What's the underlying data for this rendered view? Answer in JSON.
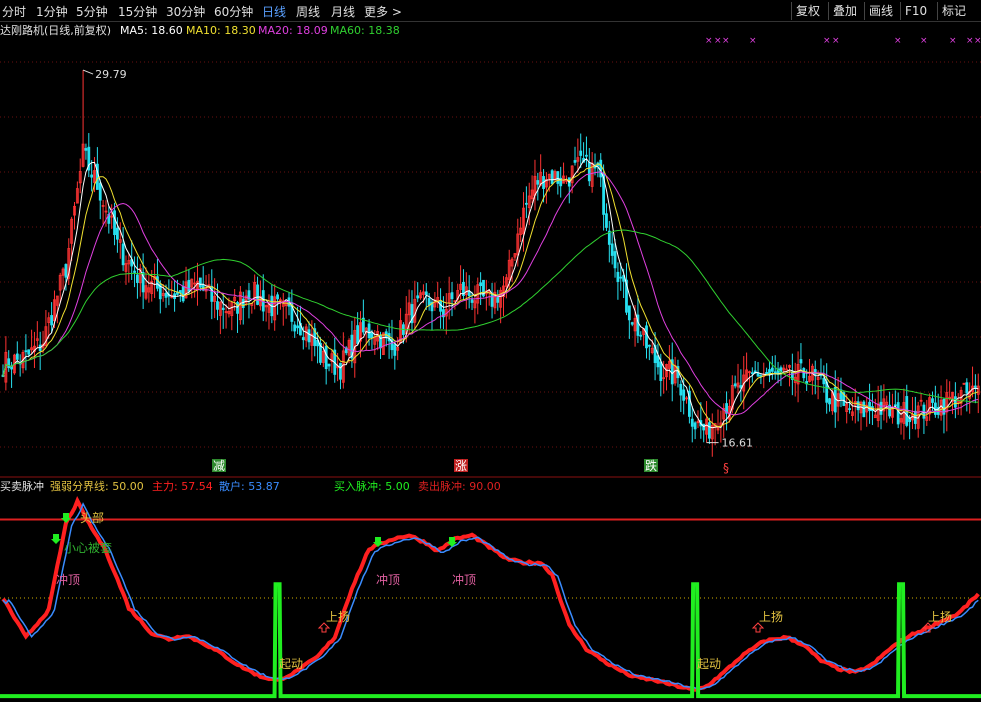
{
  "toolbar": {
    "periods": [
      "分时",
      "1分钟",
      "5分钟",
      "15分钟",
      "30分钟",
      "60分钟",
      "日线",
      "周线",
      "月线",
      "更多 >"
    ],
    "active_period": "日线",
    "right_buttons": [
      "复权",
      "叠加",
      "画线",
      "F10",
      "标记"
    ]
  },
  "colors": {
    "up": "#ff3333",
    "down": "#27e0f0",
    "ma5": "#ffffff",
    "ma10": "#f0e030",
    "ma20": "#e040e0",
    "ma60": "#30d030",
    "strong": "#ff2020",
    "weak": "#3a8cff",
    "pulse": "#20ee20",
    "threshold": "#d0b000"
  },
  "chart_data": [
    {
      "type": "candlestick",
      "title": "达刚路机(日线,前复权)",
      "indicators": [
        {
          "name": "MA5",
          "value": "18.60"
        },
        {
          "name": "MA10",
          "value": "18.30"
        },
        {
          "name": "MA20",
          "value": "18.09"
        },
        {
          "name": "MA60",
          "value": "18.38"
        }
      ],
      "ylim": [
        15.5,
        30.5
      ],
      "high_label": "29.79",
      "low_label": "16.61",
      "markers": [
        "减",
        "涨",
        "跌",
        "§"
      ],
      "anchors": [
        [
          0,
          19.4
        ],
        [
          8,
          19.6
        ],
        [
          14,
          20.2
        ],
        [
          22,
          22.8
        ],
        [
          28,
          26.8
        ],
        [
          34,
          25.5
        ],
        [
          40,
          23.6
        ],
        [
          48,
          22.4
        ],
        [
          55,
          22.0
        ],
        [
          62,
          21.8
        ],
        [
          68,
          22.2
        ],
        [
          74,
          21.6
        ],
        [
          80,
          21.3
        ],
        [
          86,
          22.0
        ],
        [
          92,
          21.5
        ],
        [
          100,
          21.2
        ],
        [
          106,
          20.6
        ],
        [
          112,
          19.5
        ],
        [
          118,
          19.3
        ],
        [
          124,
          20.4
        ],
        [
          130,
          20.6
        ],
        [
          136,
          19.9
        ],
        [
          142,
          21.2
        ],
        [
          148,
          21.6
        ],
        [
          154,
          21.3
        ],
        [
          160,
          22.0
        ],
        [
          165,
          21.8
        ],
        [
          170,
          21.6
        ],
        [
          176,
          22.2
        ],
        [
          181,
          24.5
        ],
        [
          186,
          25.8
        ],
        [
          190,
          26.1
        ],
        [
          196,
          25.9
        ],
        [
          202,
          26.4
        ],
        [
          208,
          26.2
        ],
        [
          212,
          24.0
        ],
        [
          218,
          21.5
        ],
        [
          224,
          20.2
        ],
        [
          230,
          19.2
        ],
        [
          236,
          18.9
        ],
        [
          242,
          17.3
        ],
        [
          246,
          17.0
        ],
        [
          252,
          17.9
        ],
        [
          258,
          18.6
        ],
        [
          264,
          19.1
        ],
        [
          270,
          18.9
        ],
        [
          276,
          18.9
        ],
        [
          282,
          19.1
        ],
        [
          288,
          18.3
        ],
        [
          294,
          17.8
        ],
        [
          300,
          17.7
        ],
        [
          306,
          17.9
        ],
        [
          312,
          17.6
        ],
        [
          318,
          17.7
        ],
        [
          324,
          17.8
        ],
        [
          330,
          18.1
        ],
        [
          336,
          18.3
        ],
        [
          341,
          18.4
        ]
      ],
      "high_index": 28,
      "low_index": 246
    },
    {
      "type": "line",
      "title": "买卖脉冲",
      "indicators": [
        {
          "name": "强弱分界线",
          "value": "50.00"
        },
        {
          "name": "主力",
          "value": "57.54"
        },
        {
          "name": "散户",
          "value": "53.87"
        },
        {
          "name": "买入脉冲",
          "value": "5.00"
        },
        {
          "name": "卖出脉冲",
          "value": "90.00"
        }
      ],
      "ylim": [
        -2,
        102
      ],
      "anchors": [
        [
          0,
          50
        ],
        [
          8,
          30
        ],
        [
          16,
          44
        ],
        [
          22,
          88
        ],
        [
          26,
          99
        ],
        [
          30,
          88
        ],
        [
          36,
          74
        ],
        [
          44,
          45
        ],
        [
          52,
          32
        ],
        [
          58,
          29
        ],
        [
          64,
          31
        ],
        [
          70,
          27
        ],
        [
          76,
          22
        ],
        [
          82,
          16
        ],
        [
          90,
          10
        ],
        [
          96,
          8
        ],
        [
          102,
          12
        ],
        [
          110,
          20
        ],
        [
          116,
          30
        ],
        [
          122,
          55
        ],
        [
          128,
          75
        ],
        [
          136,
          80
        ],
        [
          142,
          82
        ],
        [
          148,
          78
        ],
        [
          152,
          74
        ],
        [
          158,
          80
        ],
        [
          164,
          82
        ],
        [
          170,
          76
        ],
        [
          176,
          70
        ],
        [
          182,
          68
        ],
        [
          188,
          68
        ],
        [
          192,
          62
        ],
        [
          198,
          36
        ],
        [
          204,
          24
        ],
        [
          212,
          16
        ],
        [
          220,
          10
        ],
        [
          228,
          8
        ],
        [
          236,
          5
        ],
        [
          242,
          3
        ],
        [
          246,
          5
        ],
        [
          252,
          12
        ],
        [
          258,
          20
        ],
        [
          266,
          28
        ],
        [
          274,
          30
        ],
        [
          280,
          26
        ],
        [
          286,
          18
        ],
        [
          292,
          14
        ],
        [
          298,
          12
        ],
        [
          304,
          16
        ],
        [
          310,
          24
        ],
        [
          316,
          30
        ],
        [
          322,
          34
        ],
        [
          328,
          38
        ],
        [
          334,
          42
        ],
        [
          341,
          52
        ]
      ],
      "pulse_indices": [
        96,
        242,
        314
      ],
      "signals": {
        "top": "头部",
        "caution": "小心被套",
        "rush": "冲顶",
        "rise": "上扬",
        "start": "起动"
      }
    }
  ]
}
